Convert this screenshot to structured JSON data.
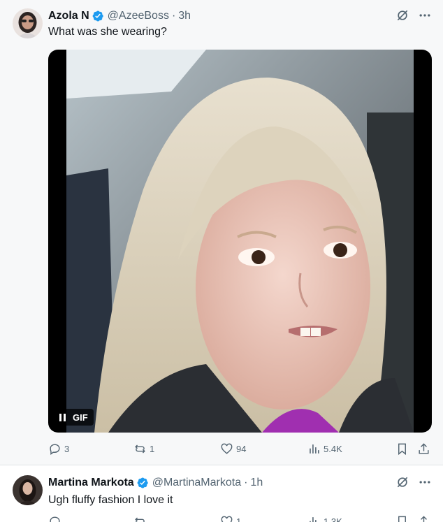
{
  "tweets": [
    {
      "author_name": "Azola N",
      "handle": "@AzeeBoss",
      "separator": "·",
      "time": "3h",
      "text": "What was she wearing?",
      "media": {
        "badge": "GIF"
      },
      "stats": {
        "replies": "3",
        "reposts": "1",
        "likes": "94",
        "views": "5.4K"
      }
    },
    {
      "author_name": "Martina Markota",
      "handle": "@MartinaMarkota",
      "separator": "·",
      "time": "1h",
      "text": "Ugh fluffy fashion I love it",
      "stats": {
        "replies": "",
        "reposts": "",
        "likes": "1",
        "views": "1.3K"
      }
    }
  ],
  "colors": {
    "verified": "#1d9bf0",
    "secondary_text": "#536471",
    "primary_text": "#0f1419"
  },
  "icons": [
    "verified-badge-icon",
    "grok-icon",
    "more-icon",
    "reply-icon",
    "repost-icon",
    "like-icon",
    "views-icon",
    "bookmark-icon",
    "share-icon",
    "pause-icon"
  ]
}
